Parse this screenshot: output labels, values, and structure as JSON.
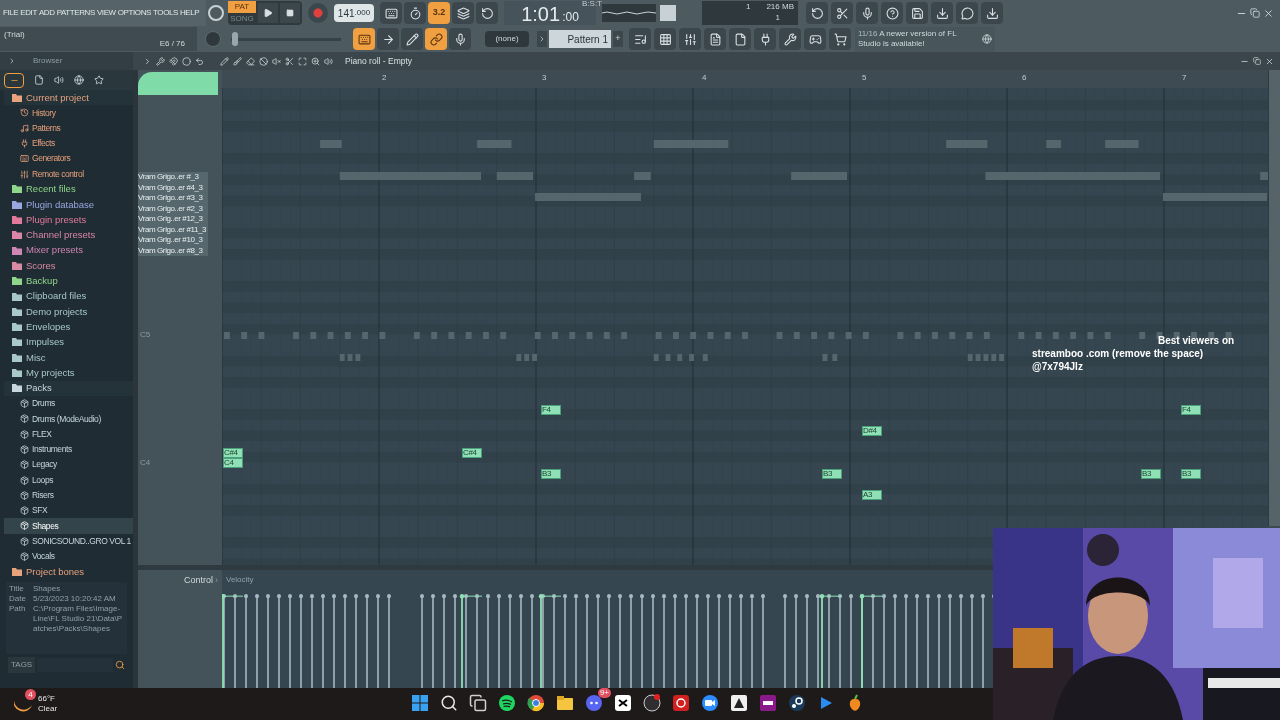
{
  "menu": [
    "FILE",
    "EDIT",
    "ADD",
    "PATTERNS",
    "VIEW",
    "OPTIONS",
    "TOOLS",
    "HELP"
  ],
  "hint_bar": {
    "text": "(Trial)",
    "counter": "E6 / 76"
  },
  "transport": {
    "modes": [
      {
        "label": "PAT",
        "selected": true
      },
      {
        "label": "SONG",
        "selected": false
      }
    ],
    "tempo": "141",
    "tempo_decimals": ".000",
    "time": "1:01",
    "time_ticks": ":00",
    "time_unit": "B:S:T"
  },
  "master_slider": {
    "level": 0.04
  },
  "toggles_top": [
    {
      "on": false
    },
    {
      "on": false
    },
    {
      "on": true,
      "label": "3.2"
    },
    {
      "on": false
    },
    {
      "on": false
    }
  ],
  "toggles_bottom": [
    {
      "on": true
    },
    {
      "on": false
    },
    {
      "on": false
    },
    {
      "on": true
    },
    {
      "on": false
    }
  ],
  "monitor": {
    "cpu": "1",
    "memory": "216 MB",
    "polyphony": "1"
  },
  "pattern_picker": {
    "channel": "(none)",
    "pattern": "Pattern 1",
    "plus": "+"
  },
  "news": {
    "count": "11/16",
    "text": "A newer version of FL Studio is available!"
  },
  "browser": {
    "title": "Browser",
    "items": [
      {
        "label": "Current project",
        "color": "#e8a27c",
        "children": [
          {
            "label": "History"
          },
          {
            "label": "Patterns"
          },
          {
            "label": "Effects"
          },
          {
            "label": "Generators"
          },
          {
            "label": "Remote control"
          }
        ]
      },
      {
        "label": "Recent files",
        "color": "#8fd68a"
      },
      {
        "label": "Plugin database",
        "color": "#9aa6e0"
      },
      {
        "label": "Plugin presets",
        "color": "#e27a9c"
      },
      {
        "label": "Channel presets",
        "color": "#d986a8"
      },
      {
        "label": "Mixer presets",
        "color": "#cf86b4"
      },
      {
        "label": "Scores",
        "color": "#d98aa4"
      },
      {
        "label": "Backup",
        "color": "#8fd68a"
      },
      {
        "label": "Clipboard files",
        "color": "#a9c8c8"
      },
      {
        "label": "Demo projects",
        "color": "#a9c8c8"
      },
      {
        "label": "Envelopes",
        "color": "#a9c8c8"
      },
      {
        "label": "Impulses",
        "color": "#a9c8c8"
      },
      {
        "label": "Misc",
        "color": "#a9c8c8"
      },
      {
        "label": "My projects",
        "color": "#a9c8c8"
      },
      {
        "label": "Packs",
        "color": "#c6d6dc",
        "children": [
          {
            "label": "Drums",
            "selected": false
          },
          {
            "label": "Drums (ModeAudio)",
            "selected": false
          },
          {
            "label": "FLEX",
            "selected": false
          },
          {
            "label": "Instruments",
            "selected": false
          },
          {
            "label": "Legacy",
            "selected": false
          },
          {
            "label": "Loops",
            "selected": false
          },
          {
            "label": "Risers",
            "selected": false
          },
          {
            "label": "SFX",
            "selected": false
          },
          {
            "label": "Shapes",
            "selected": true
          },
          {
            "label": "SONICSOUND..GRO VOL 1",
            "selected": false
          },
          {
            "label": "Vocals",
            "selected": false
          }
        ]
      },
      {
        "label": "Project bones",
        "color": "#e8a27c"
      }
    ],
    "info": [
      {
        "key": "Title",
        "value": "Shapes"
      },
      {
        "key": "Date",
        "value": "5/23/2023 10:20:42 AM"
      },
      {
        "key": "Path",
        "value": "C:\\Program Files\\Image-Line\\FL Studio 21\\Data\\Patches\\Packs\\Shapes"
      }
    ],
    "tags_label": "TAGS"
  },
  "piano_roll": {
    "title": "Piano roll - Empty",
    "ruler": [
      "2",
      "3",
      "4",
      "5",
      "6",
      "7"
    ],
    "channels": [
      "Vram Grigo..er #_3",
      "Vram Grigo..er #4_3",
      "Vram Grigo..er #3_3",
      "Vram Grigo..er #2_3",
      "Vram Grig..er #12_3",
      "Vram Grigo..er #11_3",
      "Vram Grig..er #10_3",
      "Vram Grigo..er #8_3"
    ],
    "keys": [
      "C5",
      "C4"
    ],
    "notes": [
      {
        "label": "C#4"
      },
      {
        "label": "C4"
      },
      {
        "label": "C#4"
      },
      {
        "label": "F4"
      },
      {
        "label": "B3"
      },
      {
        "label": "B3"
      },
      {
        "label": "D#4"
      },
      {
        "label": "A3"
      },
      {
        "label": "B3"
      },
      {
        "label": "F4"
      },
      {
        "label": "B3"
      }
    ],
    "control_label": "Control",
    "control_arrow": "›",
    "lane_label": "Velocity"
  },
  "overlay_text": [
    "Best viewers on",
    "streamboo .com (remove the space)",
    "@7x794Jlz"
  ],
  "taskbar": {
    "weather": {
      "badge": "4",
      "temperature": "66°F",
      "condition": "Clear"
    },
    "discord_badge": "9+"
  }
}
